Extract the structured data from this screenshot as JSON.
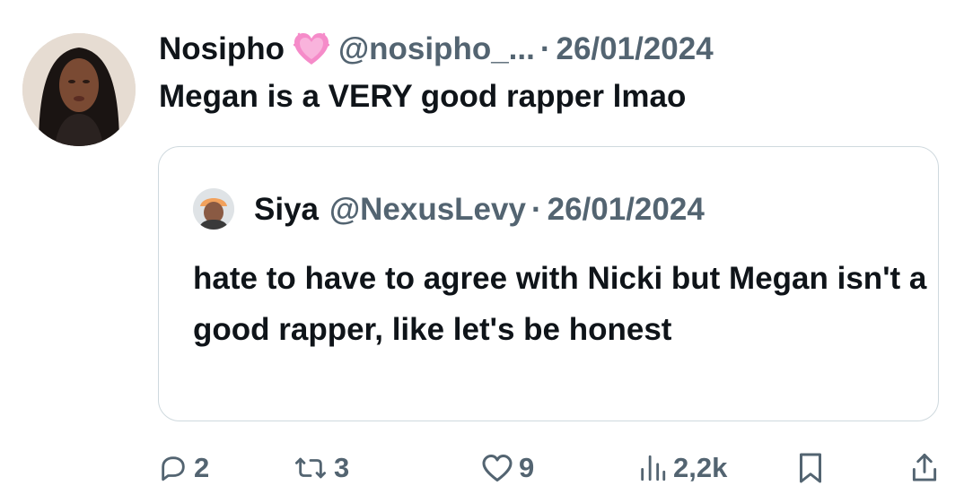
{
  "tweet": {
    "author_name": "Nosipho",
    "author_badge": "pink-heart-emoji",
    "author_handle": "@nosipho_...",
    "separator": "·",
    "date": "26/01/2024",
    "text": "Megan is a VERY good rapper lmao"
  },
  "quoted_tweet": {
    "author_name": "Siya",
    "author_handle": "@NexusLevy",
    "separator": "·",
    "date": "26/01/2024",
    "text": "hate to have to agree with Nicki but Megan isn't a good rapper, like let's be honest"
  },
  "actions": {
    "reply_count": "2",
    "retweet_count": "3",
    "like_count": "9",
    "view_count": "2,2k"
  },
  "colors": {
    "text_primary": "#0f1419",
    "text_secondary": "#536471",
    "border": "#cfd9de",
    "heart": "#f58bc9"
  }
}
